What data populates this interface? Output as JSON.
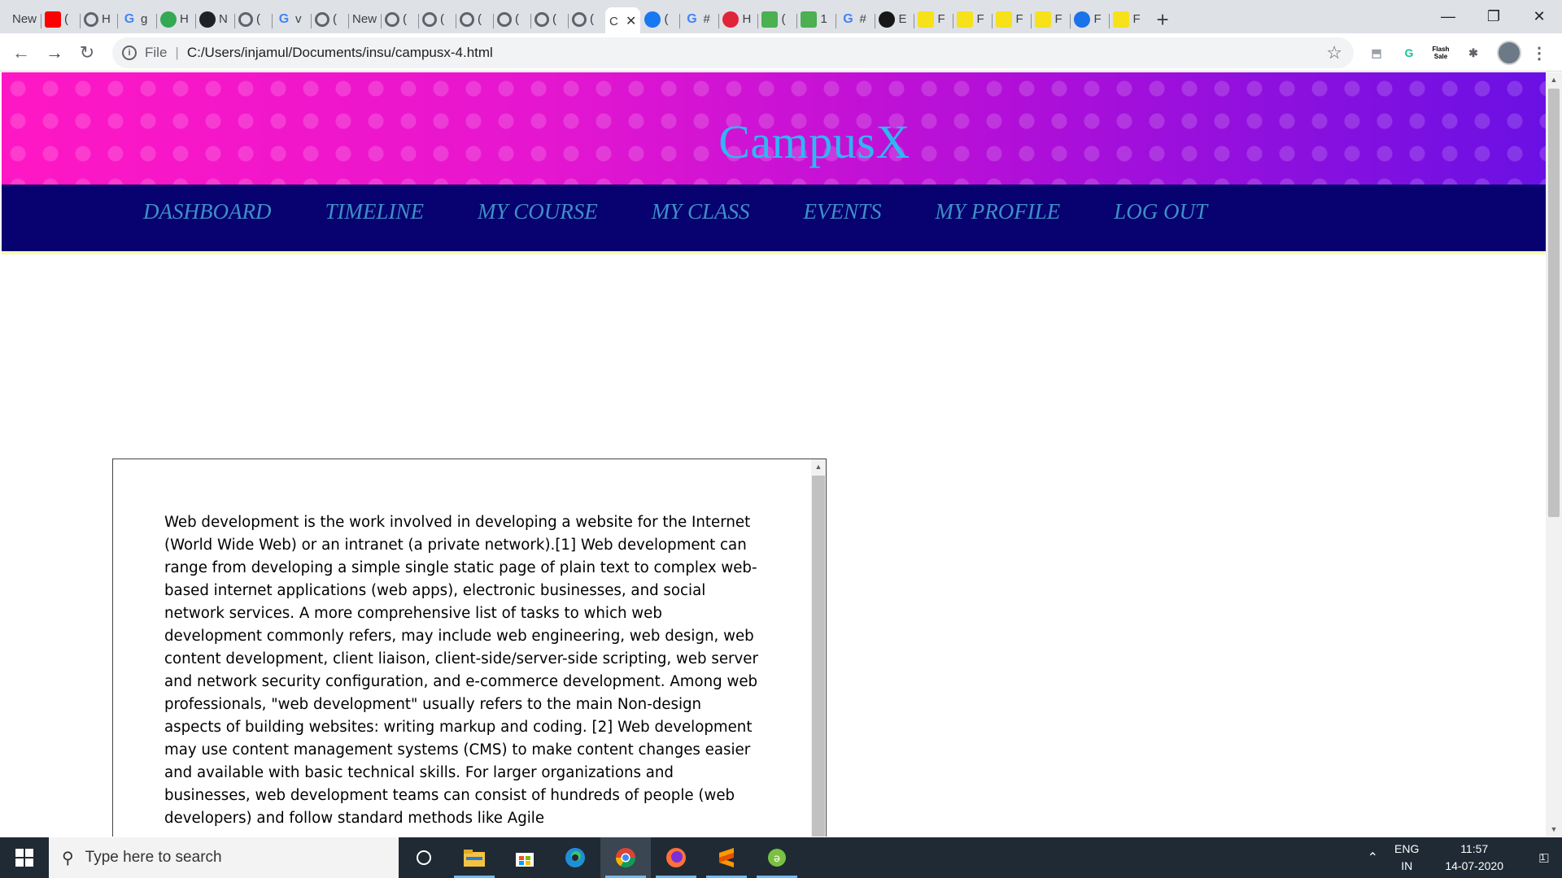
{
  "browser": {
    "tabs": [
      {
        "label": "New",
        "icon": "none"
      },
      {
        "label": "(",
        "icon": "youtube-icon",
        "color": "#ff0000"
      },
      {
        "label": "H",
        "icon": "globe-icon",
        "color": "#5f6368"
      },
      {
        "label": "g",
        "icon": "google-icon",
        "color": "#4285f4"
      },
      {
        "label": "H",
        "icon": "paint-icon",
        "color": "#34a853"
      },
      {
        "label": "N",
        "icon": "graduation-cap-icon",
        "color": "#202124"
      },
      {
        "label": "(",
        "icon": "globe-icon",
        "color": "#5f6368"
      },
      {
        "label": "v",
        "icon": "google-icon",
        "color": "#4285f4"
      },
      {
        "label": "(",
        "icon": "globe-icon",
        "color": "#5f6368"
      },
      {
        "label": "New",
        "icon": "none"
      },
      {
        "label": "(",
        "icon": "globe-icon",
        "color": "#5f6368"
      },
      {
        "label": "(",
        "icon": "globe-icon",
        "color": "#5f6368"
      },
      {
        "label": "(",
        "icon": "globe-icon",
        "color": "#5f6368"
      },
      {
        "label": "(",
        "icon": "globe-icon",
        "color": "#5f6368"
      },
      {
        "label": "(",
        "icon": "globe-icon",
        "color": "#5f6368"
      },
      {
        "label": "(",
        "icon": "globe-icon",
        "color": "#5f6368"
      },
      {
        "label": "C",
        "icon": "none",
        "active": true
      },
      {
        "label": "(",
        "icon": "facebook-icon",
        "color": "#1877f2"
      },
      {
        "label": "#",
        "icon": "google-icon",
        "color": "#4285f4"
      },
      {
        "label": "H",
        "icon": "opera-icon",
        "color": "#e0243a"
      },
      {
        "label": "(",
        "icon": "w3-icon",
        "color": "#4caf50"
      },
      {
        "label": "1",
        "icon": "w3-icon",
        "color": "#4caf50"
      },
      {
        "label": "#",
        "icon": "google-icon",
        "color": "#4285f4"
      },
      {
        "label": "E",
        "icon": "github-icon",
        "color": "#181717"
      },
      {
        "label": "F",
        "icon": "flipkart-icon",
        "color": "#f7e11a"
      },
      {
        "label": "F",
        "icon": "flipkart-icon",
        "color": "#f7e11a"
      },
      {
        "label": "F",
        "icon": "flipkart-icon",
        "color": "#f7e11a"
      },
      {
        "label": "F",
        "icon": "flipkart-icon",
        "color": "#f7e11a"
      },
      {
        "label": "F",
        "icon": "gauge-icon",
        "color": "#1a73e8"
      },
      {
        "label": "F",
        "icon": "flipkart-icon",
        "color": "#f7e11a"
      }
    ],
    "new_tab": "+",
    "window_controls": {
      "minimize": "—",
      "restore": "❐",
      "close": "✕"
    },
    "address": {
      "scheme": "File",
      "url": "C:/Users/injamul/Documents/insu/campusx-4.html"
    },
    "extensions": [
      {
        "name": "pdf-icon",
        "glyph": "⬒",
        "color": "#9aa0a6"
      },
      {
        "name": "grammarly-icon",
        "glyph": "G",
        "color": "#15c39a"
      },
      {
        "name": "flash-sale-icon",
        "glyph": "Flash Sale",
        "color": "#d93025"
      },
      {
        "name": "puzzle-icon",
        "glyph": "✱",
        "color": "#5f6368"
      }
    ]
  },
  "page": {
    "brand": "CampusX",
    "nav": [
      "DASHBOARD",
      "TIMELINE",
      "MY COURSE",
      "MY CLASS",
      "EVENTS",
      "MY PROFILE",
      "LOG OUT"
    ],
    "article": "Web development is the work involved in developing a website for the Internet (World Wide Web) or an intranet (a private network).[1] Web development can range from developing a simple single static page of plain text to complex web-based internet applications (web apps), electronic businesses, and social network services. A more comprehensive list of tasks to which web development commonly refers, may include web engineering, web design, web content development, client liaison, client-side/server-side scripting, web server and network security configuration, and e-commerce development. Among web professionals, \"web development\" usually refers to the main Non-design aspects of building websites: writing markup and coding. [2] Web development may use content management systems (CMS) to make content changes easier and available with basic technical skills. For larger organizations and businesses, web development teams can consist of hundreds of people (web developers) and follow standard methods like Agile"
  },
  "taskbar": {
    "search_placeholder": "Type here to search",
    "apps": [
      "cortana-icon",
      "file-explorer-icon",
      "store-icon",
      "edge-icon",
      "chrome-icon",
      "firefox-icon",
      "sublime-icon",
      "app-icon"
    ],
    "lang_line1": "ENG",
    "lang_line2": "IN",
    "time": "11:57",
    "date": "14-07-2020",
    "notifications": "1"
  }
}
